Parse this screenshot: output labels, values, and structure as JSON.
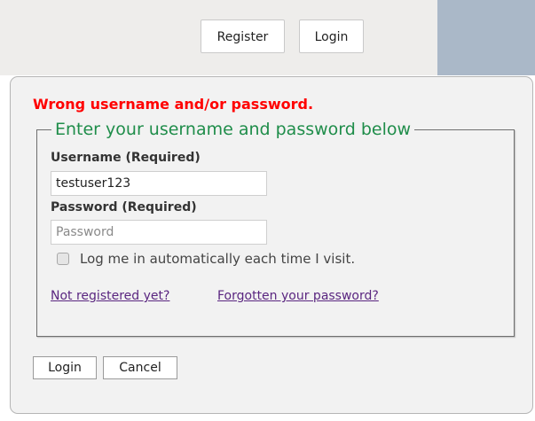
{
  "nav": {
    "register_label": "Register",
    "login_label": "Login"
  },
  "login_form": {
    "error_message": "Wrong username and/or password.",
    "legend": "Enter your username and password below",
    "username_label": "Username (Required)",
    "username_value": "testuser123",
    "password_label": "Password (Required)",
    "password_placeholder": "Password",
    "remember_label": "Log me in automatically each time I visit.",
    "remember_checked": false,
    "not_registered_link": "Not registered yet?",
    "forgot_password_link": "Forgotten your password?",
    "login_button": "Login",
    "cancel_button": "Cancel"
  },
  "colors": {
    "error": "#ff0000",
    "legend": "#1f8d4a",
    "link": "#5a2680",
    "header_accent": "#aab8c8"
  }
}
